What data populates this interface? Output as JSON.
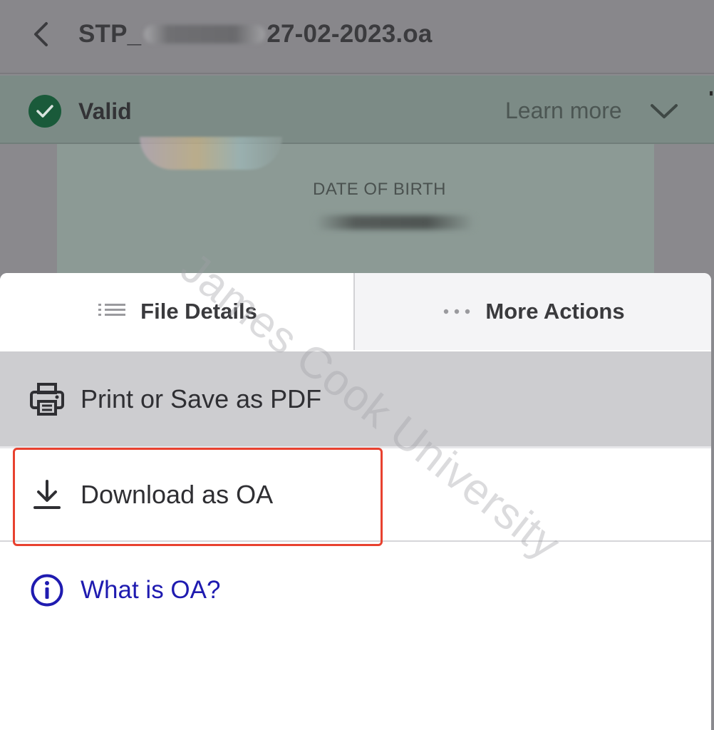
{
  "header": {
    "title_prefix": "STP_",
    "title_suffix": "27-02-2023.oa"
  },
  "validation": {
    "status": "Valid",
    "learn_more": "Learn more"
  },
  "document": {
    "dob_label": "DATE OF BIRTH"
  },
  "sheet": {
    "tabs": [
      {
        "label": "File Details",
        "icon": "list-icon"
      },
      {
        "label": "More Actions",
        "icon": "ellipsis-icon"
      }
    ],
    "actions": [
      {
        "label": "Print or Save as PDF",
        "icon": "printer-icon"
      },
      {
        "label": "Download as OA",
        "icon": "download-icon"
      },
      {
        "label": "What is OA?",
        "icon": "info-icon"
      }
    ]
  },
  "watermark": "James Cook University",
  "colors": {
    "valid_green": "#1a5a3a",
    "link_blue": "#1f1bb0",
    "highlight_red": "#e8412f"
  }
}
